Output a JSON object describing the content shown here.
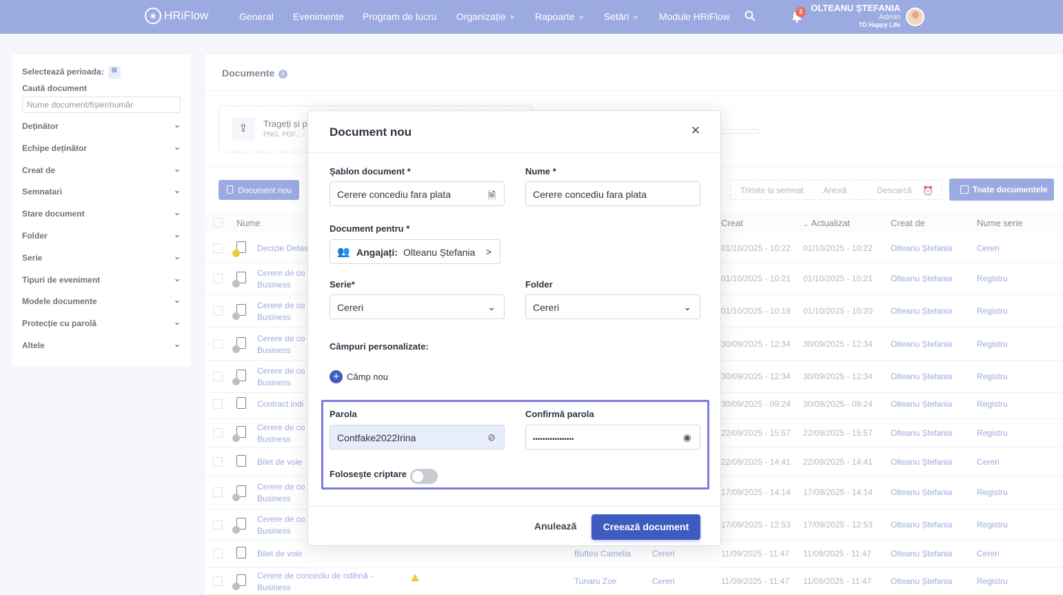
{
  "header": {
    "logo": "HRiFlow",
    "nav": [
      "General",
      "Evenimente",
      "Program de lucru",
      "Organizație",
      "Rapoarte",
      "Setări",
      "Module HRiFlow"
    ],
    "notif_count": "3",
    "user_name": "OLTEANU ȘTEFANIA",
    "user_role": "Admin",
    "user_company": "TD Happy Life"
  },
  "sidebar": {
    "period_label": "Selectează perioada:",
    "search_label": "Caută document",
    "search_placeholder": "Nume document/fișier/număr",
    "filters": [
      "Deținător",
      "Echipe deținător",
      "Creat de",
      "Semnatari",
      "Stare document",
      "Folder",
      "Serie",
      "Tipuri de eveniment",
      "Modele documente",
      "Protecție cu parolă",
      "Altele"
    ]
  },
  "main": {
    "title": "Documente",
    "drop_text": "Trageți și p",
    "drop_sub": "PNG, PDF... -",
    "new_doc": "Document nou",
    "toolbar": [
      "Trimite la semnat",
      "Anexă",
      "Descarcă"
    ],
    "all_docs": "Toate documentele",
    "columns": [
      "Nume",
      "Creat",
      "Actualizat",
      "Creat de",
      "Nume serie"
    ]
  },
  "table": [
    {
      "name": "Decizie Detas",
      "name2": "",
      "owner": "",
      "folder": "",
      "created": "01/10/2025 - 10:22",
      "updated": "01/10/2025 - 10:22",
      "by": "Olteanu Ștefania",
      "series": "Cereri"
    },
    {
      "name": "Cerere de co",
      "name2": "Business",
      "owner": "",
      "folder": "",
      "created": "01/10/2025 - 10:21",
      "updated": "01/10/2025 - 10:21",
      "by": "Olteanu Ștefania",
      "series": "Registru"
    },
    {
      "name": "Cerere de co",
      "name2": "Business",
      "owner": "",
      "folder": "",
      "created": "01/10/2025 - 10:19",
      "updated": "01/10/2025 - 10:20",
      "by": "Olteanu Ștefania",
      "series": "Registru"
    },
    {
      "name": "Cerere de co",
      "name2": "Business",
      "owner": "",
      "folder": "",
      "created": "30/09/2025 - 12:34",
      "updated": "30/09/2025 - 12:34",
      "by": "Olteanu Ștefania",
      "series": "Registru"
    },
    {
      "name": "Cerere de co",
      "name2": "Business",
      "owner": "",
      "folder": "",
      "created": "30/09/2025 - 12:34",
      "updated": "30/09/2025 - 12:34",
      "by": "Olteanu Ștefania",
      "series": "Registru"
    },
    {
      "name": "Contract indi",
      "name2": "",
      "owner": "",
      "folder": "",
      "created": "30/09/2025 - 09:24",
      "updated": "30/09/2025 - 09:24",
      "by": "Olteanu Ștefania",
      "series": "Registru"
    },
    {
      "name": "Cerere de co",
      "name2": "Business",
      "owner": "",
      "folder": "",
      "created": "22/09/2025 - 15:57",
      "updated": "22/09/2025 - 15:57",
      "by": "Olteanu Ștefania",
      "series": "Registru"
    },
    {
      "name": "Bilet de voie",
      "name2": "",
      "owner": "",
      "folder": "",
      "created": "22/09/2025 - 14:41",
      "updated": "22/09/2025 - 14:41",
      "by": "Olteanu Ștefania",
      "series": "Cereri"
    },
    {
      "name": "Cerere de co",
      "name2": "Business",
      "owner": "",
      "folder": "",
      "created": "17/09/2025 - 14:14",
      "updated": "17/09/2025 - 14:14",
      "by": "Olteanu Ștefania",
      "series": "Registru"
    },
    {
      "name": "Cerere de co",
      "name2": "Business",
      "owner": "",
      "folder": "",
      "created": "17/09/2025 - 12:53",
      "updated": "17/09/2025 - 12:53",
      "by": "Olteanu Ștefania",
      "series": "Registru"
    },
    {
      "name": "Bilet de voie",
      "name2": "",
      "owner": "Buftea Camelia",
      "folder": "Cereri",
      "created": "11/09/2025 - 11:47",
      "updated": "11/09/2025 - 11:47",
      "by": "Olteanu Ștefania",
      "series": "Cereri"
    },
    {
      "name": "Cerere de concediu de odihnă -",
      "name2": "Business",
      "owner": "Tunaru Zoe",
      "folder": "Cereri",
      "created": "11/09/2025 - 11:47",
      "updated": "11/09/2025 - 11:47",
      "by": "Olteanu Ștefania",
      "series": "Registru"
    }
  ],
  "modal": {
    "title": "Document nou",
    "template_label": "Șablon document *",
    "template_value": "Cerere concediu fara plata",
    "name_label": "Nume *",
    "name_value": "Cerere concediu fara plata",
    "for_label": "Document pentru *",
    "for_prefix": "Angajați:",
    "for_value": "Olteanu Ștefania",
    "series_label": "Serie*",
    "series_value": "Cereri",
    "folder_label": "Folder",
    "folder_value": "Cereri",
    "custom_label": "Câmpuri personalizate:",
    "new_field": "Câmp nou",
    "password_label": "Parola",
    "password_value": "Contfake2022Irina",
    "confirm_label": "Confirmă parola",
    "confirm_value": "•••••••••••••••••",
    "encrypt_label": "Folosește criptare",
    "cancel": "Anulează",
    "create": "Creează document"
  },
  "colors": {
    "accent": "#7a8ed6",
    "primary": "#3e5bbf",
    "highlight": "#7b7be0"
  }
}
